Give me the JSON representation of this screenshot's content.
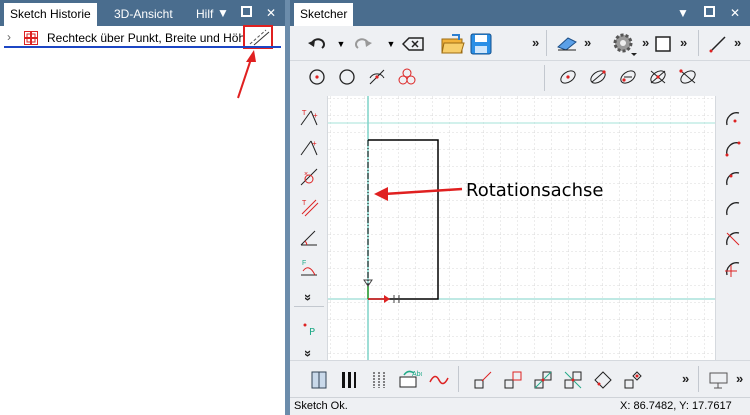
{
  "left_panel": {
    "tabs": [
      {
        "label": "Sketch Historie"
      },
      {
        "label": "3D-Ansicht"
      },
      {
        "label": "Hilf"
      }
    ],
    "tree_item": {
      "label": "Rechteck über Punkt, Breite und Höhe"
    }
  },
  "right_panel": {
    "tab": {
      "label": "Sketcher"
    }
  },
  "canvas": {
    "annotation": "Rotationsachse"
  },
  "status": {
    "message": "Sketch Ok.",
    "coords": "X: 86.7482, Y: 17.7617"
  },
  "colors": {
    "tab_bar": "#4a6d8e",
    "highlight_box": "#e02020",
    "annotation_arrow": "#e02020",
    "tree_underline": "#1c46c4",
    "axis_line": "#7fd3c8",
    "grid": "#dcdcdc"
  }
}
